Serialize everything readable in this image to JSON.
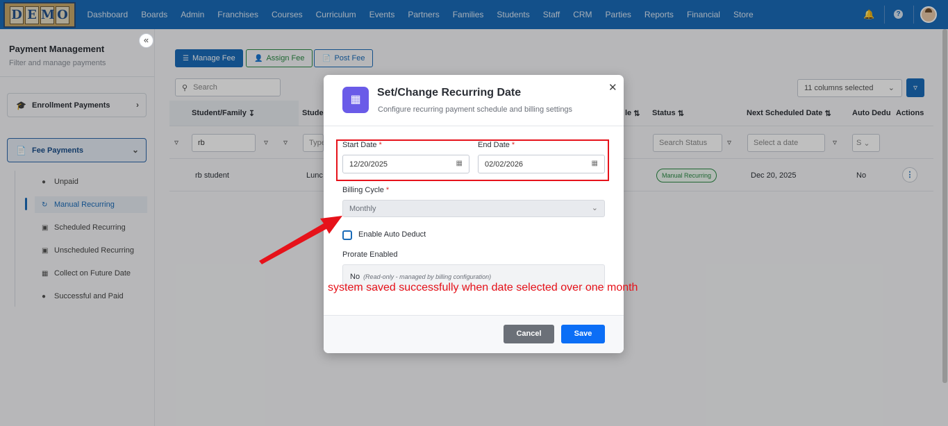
{
  "logo_letters": [
    "D",
    "E",
    "M",
    "O"
  ],
  "nav": [
    "Dashboard",
    "Boards",
    "Admin",
    "Franchises",
    "Courses",
    "Curriculum",
    "Events",
    "Partners",
    "Families",
    "Students",
    "Staff",
    "CRM",
    "Parties",
    "Reports",
    "Financial",
    "Store"
  ],
  "sidebar": {
    "title": "Payment Management",
    "subtitle": "Filter and manage payments",
    "enrollment": "Enrollment Payments",
    "fee": "Fee Payments",
    "items": [
      "Unpaid",
      "Manual Recurring",
      "Scheduled Recurring",
      "Unscheduled Recurring",
      "Collect on Future Date",
      "Successful and Paid"
    ],
    "active_item": "Manual Recurring"
  },
  "toolbar": {
    "manage": "Manage Fee",
    "assign": "Assign Fee",
    "post": "Post Fee",
    "search_placeholder": "Search",
    "columns": "11 columns selected"
  },
  "table": {
    "headers": {
      "student": "Student/Family",
      "student2": "Stude",
      "sched": "le",
      "status": "Status",
      "next": "Next Scheduled Date",
      "auto": "Auto Dedu",
      "actions": "Actions"
    },
    "filters": {
      "student": "rb",
      "type": "Type",
      "status": "Search Status",
      "date": "Select a date",
      "auto": "S"
    },
    "row": {
      "student": "rb student",
      "student2": "Lunc",
      "status": "Manual Recurring",
      "next": "Dec 20, 2025",
      "auto": "No"
    }
  },
  "modal": {
    "title": "Set/Change Recurring Date",
    "subtitle": "Configure recurring payment schedule and billing settings",
    "start_label": "Start Date",
    "start_value": "12/20/2025",
    "end_label": "End Date",
    "end_value": "02/02/2026",
    "billing_label": "Billing Cycle",
    "billing_value": "Monthly",
    "auto_deduct": "Enable Auto Deduct",
    "prorate_label": "Prorate Enabled",
    "prorate_value": "No",
    "prorate_note": "(Read-only - managed by billing configuration)",
    "cancel": "Cancel",
    "save": "Save"
  },
  "annotation": "system saved successfully when date selected over one month",
  "colors": {
    "nav": "#1a6bb8",
    "annotation": "#e6121a",
    "save": "#0b6ef6",
    "modal_icon": "#6a5be8"
  }
}
